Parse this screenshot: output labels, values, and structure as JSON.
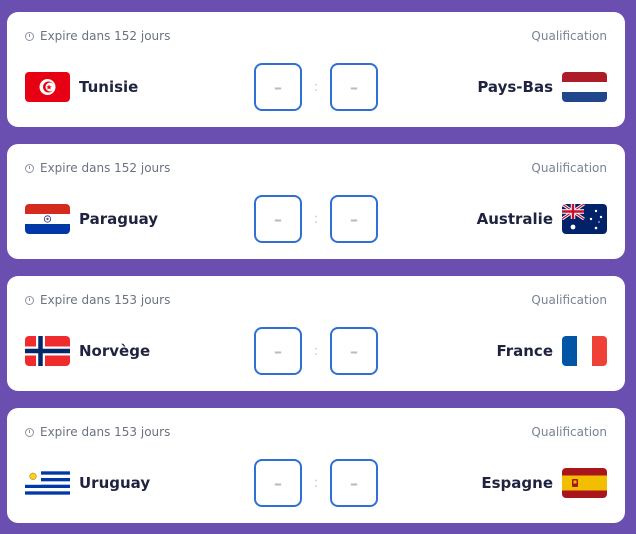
{
  "matches": [
    {
      "expiry": "Expire dans 152 jours",
      "phase": "Qualification",
      "home": {
        "name": "Tunisie",
        "flag": "tunisia-flag"
      },
      "away": {
        "name": "Pays-Bas",
        "flag": "netherlands-flag"
      },
      "home_score": "–",
      "away_score": "–",
      "separator": ":"
    },
    {
      "expiry": "Expire dans 152 jours",
      "phase": "Qualification",
      "home": {
        "name": "Paraguay",
        "flag": "paraguay-flag"
      },
      "away": {
        "name": "Australie",
        "flag": "australia-flag"
      },
      "home_score": "–",
      "away_score": "–",
      "separator": ":"
    },
    {
      "expiry": "Expire dans 153 jours",
      "phase": "Qualification",
      "home": {
        "name": "Norvège",
        "flag": "norway-flag"
      },
      "away": {
        "name": "France",
        "flag": "france-flag"
      },
      "home_score": "–",
      "away_score": "–",
      "separator": ":"
    },
    {
      "expiry": "Expire dans 153 jours",
      "phase": "Qualification",
      "home": {
        "name": "Uruguay",
        "flag": "uruguay-flag"
      },
      "away": {
        "name": "Espagne",
        "flag": "spain-flag"
      },
      "home_score": "–",
      "away_score": "–",
      "separator": ":"
    }
  ],
  "colors": {
    "background": "#6a4fb0",
    "card": "#ffffff",
    "input_border": "#2f6fd6",
    "team_text": "#1f2340"
  }
}
